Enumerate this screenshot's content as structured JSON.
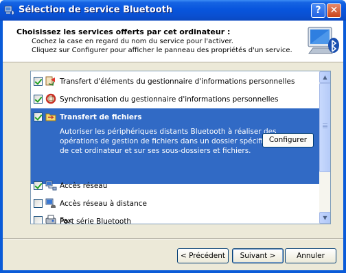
{
  "window": {
    "title": "Sélection de service Bluetooth",
    "help_label": "?",
    "close_label": "✕"
  },
  "header": {
    "title": "Choisissez les services offerts par cet ordinateur :",
    "line1": "Cochez la case en regard du nom du service pour l'activer.",
    "line2": "Cliquez sur Configurer pour afficher le panneau des propriétés d'un service."
  },
  "services": [
    {
      "label": "Transfert d'éléments du gestionnaire d'informations personnelles",
      "checked": true
    },
    {
      "label": "Synchronisation du gestionnaire d'informations personnelles",
      "checked": true
    },
    {
      "label": "Transfert de fichiers",
      "checked": true,
      "selected": true,
      "description": [
        "Autoriser les périphériques distants Bluetooth à réaliser des",
        "opérations de gestion de fichiers dans un dossier spécifique",
        "de cet ordinateur et sur ses sous-dossiers et fichiers."
      ],
      "configure_label": "Configurer"
    },
    {
      "label": "Accès réseau",
      "checked": true
    },
    {
      "label": "Accès réseau à distance",
      "checked": false
    },
    {
      "label": "Port série Bluetooth",
      "checked": true
    },
    {
      "label": "Fax",
      "checked": false
    }
  ],
  "scrollbar": {
    "up": "▲",
    "down": "▼"
  },
  "buttons": {
    "previous": "< Précédent",
    "next": "Suivant >",
    "cancel": "Annuler"
  },
  "colors": {
    "selection": "#316ac5",
    "titlebar": "#0855dd",
    "dialog": "#ece9d8"
  }
}
